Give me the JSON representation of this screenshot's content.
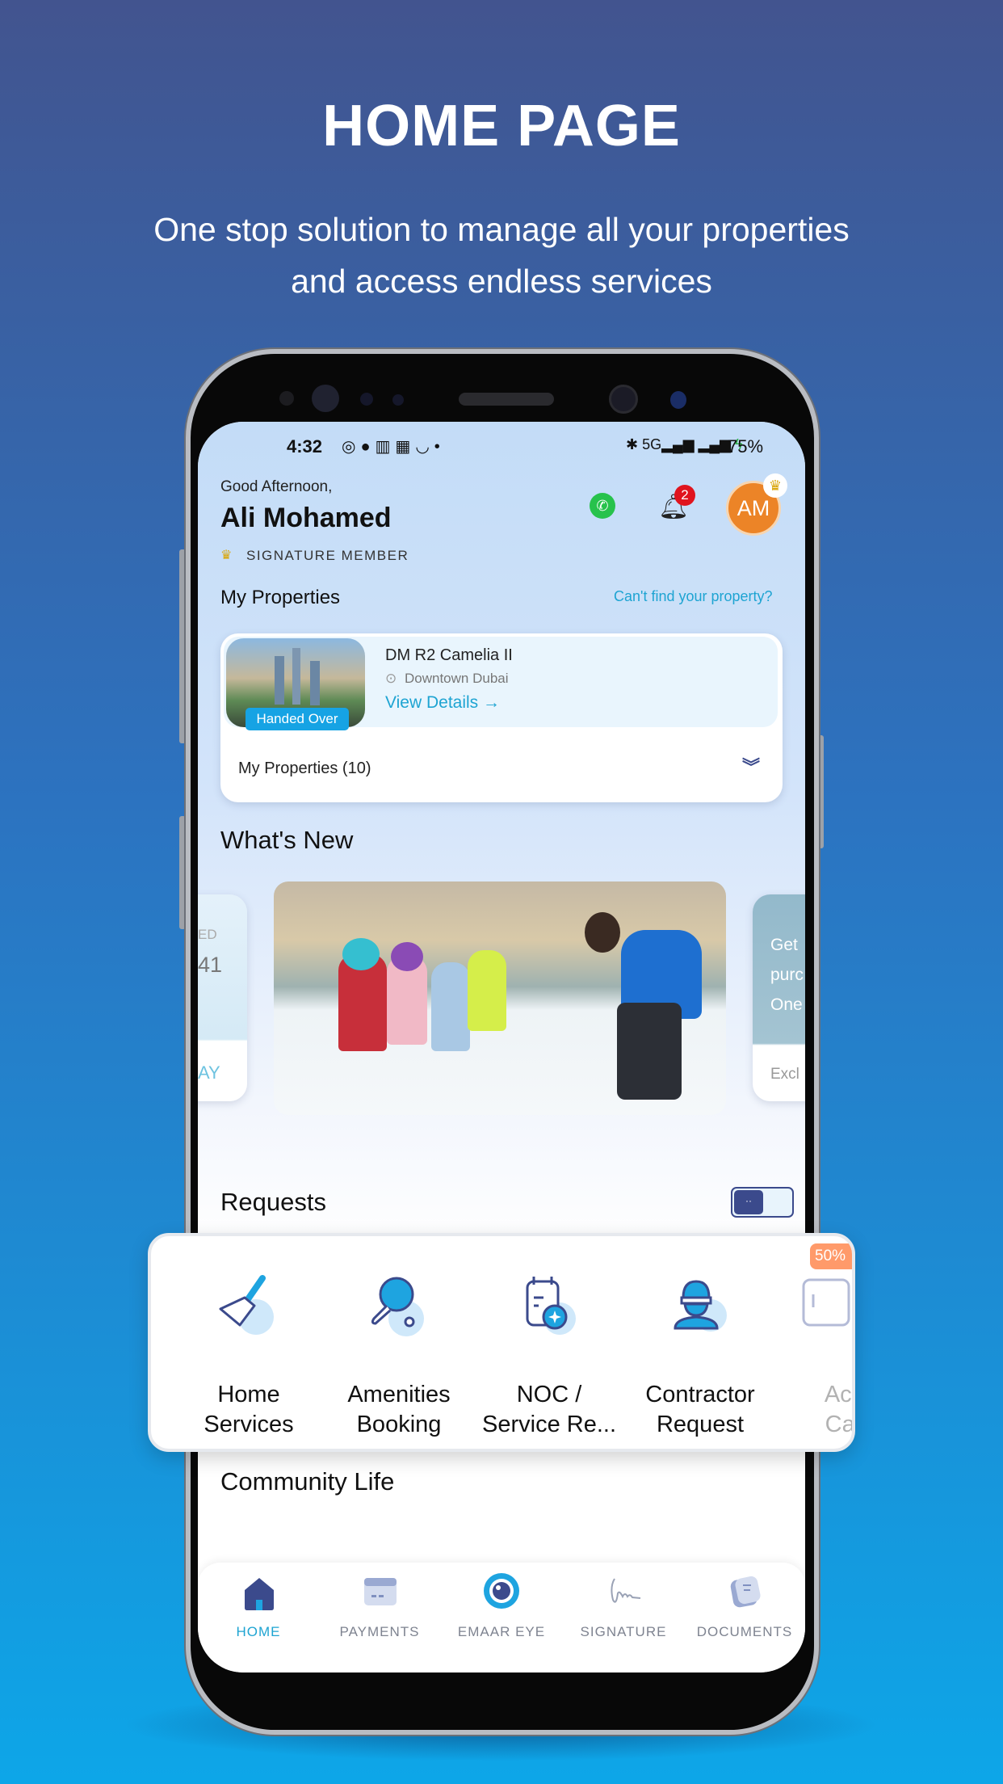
{
  "promo": {
    "title": "HOME PAGE",
    "subtitle_line1": "One stop solution to manage all your properties",
    "subtitle_line2": "and access endless services"
  },
  "status_bar": {
    "time": "4:32",
    "network": "5G",
    "battery": "75%"
  },
  "header": {
    "greeting": "Good Afternoon,",
    "user_name": "Ali Mohamed",
    "membership": "SIGNATURE MEMBER",
    "avatar_initials": "AM",
    "notification_count": "2",
    "icons": [
      "whatsapp-icon",
      "bell-icon",
      "crown-icon"
    ]
  },
  "properties": {
    "section_title": "My Properties",
    "help_link": "Can't find your property?",
    "featured": {
      "name": "DM R2 Camelia II",
      "location": "Downtown Dubai",
      "status": "Handed Over",
      "cta": "View Details →"
    },
    "dropdown_label": "My Properties (10)"
  },
  "whats_new": {
    "title": "What's New",
    "left_card_partial": {
      "line1": "ED",
      "line2": "41",
      "cta": "AY"
    },
    "right_card_partial": {
      "line1": "Get",
      "line2": "purc",
      "line3": "One",
      "footer": "Excl"
    }
  },
  "requests": {
    "title": "Requests",
    "items": [
      {
        "line1": "Home",
        "line2": "Services",
        "icon": "broom-icon"
      },
      {
        "line1": "Amenities",
        "line2": "Booking",
        "icon": "ping-pong-icon"
      },
      {
        "line1": "NOC /",
        "line2": "Service Re...",
        "icon": "calendar-document-icon"
      },
      {
        "line1": "Contractor",
        "line2": "Request",
        "icon": "worker-helmet-icon"
      },
      {
        "line1": "Acc",
        "line2": "Car",
        "icon": "access-card-icon",
        "badge": "50%"
      }
    ]
  },
  "community": {
    "title": "Community Life"
  },
  "bottom_nav": {
    "active": "HOME",
    "items": [
      {
        "label": "HOME",
        "icon": "home-icon"
      },
      {
        "label": "PAYMENTS",
        "icon": "card-icon"
      },
      {
        "label": "EMAAR EYE",
        "icon": "eye-icon"
      },
      {
        "label": "SIGNATURE",
        "icon": "signature-icon"
      },
      {
        "label": "DOCUMENTS",
        "icon": "documents-icon"
      }
    ]
  },
  "colors": {
    "accent": "#1ea4d2",
    "navy": "#3b4a8c",
    "avatar": "#ec8427",
    "badge_red": "#e0141e",
    "discount": "#ff9a6a"
  }
}
